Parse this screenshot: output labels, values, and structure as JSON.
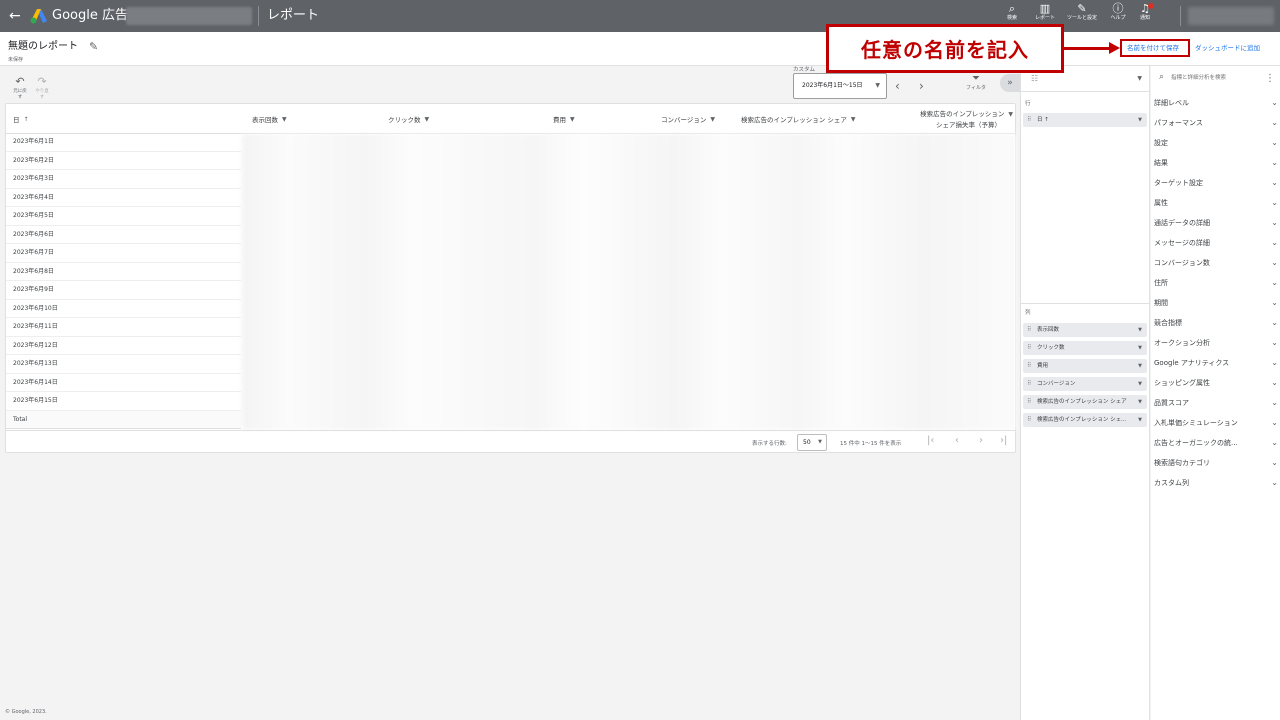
{
  "app": {
    "brand": "Google 広告",
    "page_title": "レポート"
  },
  "top_icons": [
    {
      "icon": "search-icon",
      "glyph": "🔍",
      "label": "検索"
    },
    {
      "icon": "reports-icon",
      "glyph": "▥",
      "label": "レポート"
    },
    {
      "icon": "tools-icon",
      "glyph": "🔧",
      "label": "ツールと設定"
    },
    {
      "icon": "help-icon",
      "glyph": "?",
      "label": "ヘルプ"
    },
    {
      "icon": "bell-icon",
      "glyph": "🔔",
      "label": "通知"
    }
  ],
  "header": {
    "report_name": "無題のレポート",
    "status": "未保存",
    "save_link": "名前を付けて保存",
    "dashboard_link": "ダッシュボードに追加"
  },
  "callout": {
    "text": "任意の名前を記入",
    "color": "#c00000"
  },
  "toolbar": {
    "undo": "元に戻す",
    "redo": "やり直す",
    "custom_label": "カスタム",
    "date_range": "2023年6月1日〜15日",
    "filter": "フィルタ"
  },
  "table": {
    "columns": [
      "日",
      "表示回数",
      "クリック数",
      "費用",
      "コンバージョン",
      "検索広告のインプレッション シェア",
      "検索広告のインプレッション シェア損失率（予算）"
    ],
    "col_last_line1": "検索広告のインプレッション",
    "col_last_line2": "シェア損失率（予算）",
    "rows": [
      "2023年6月1日",
      "2023年6月2日",
      "2023年6月3日",
      "2023年6月4日",
      "2023年6月5日",
      "2023年6月6日",
      "2023年6月7日",
      "2023年6月8日",
      "2023年6月9日",
      "2023年6月10日",
      "2023年6月11日",
      "2023年6月12日",
      "2023年6月13日",
      "2023年6月14日",
      "2023年6月15日"
    ],
    "total": "Total"
  },
  "pager": {
    "rows_label": "表示する行数:",
    "rows_value": "50",
    "info": "15 件中 1〜15 件を表示"
  },
  "footer": "© Google, 2023.",
  "middle_panel": {
    "rows_label": "行",
    "rows_chips": [
      "日"
    ],
    "cols_label": "列",
    "col_chips": [
      "表示回数",
      "クリック数",
      "費用",
      "コンバージョン",
      "検索広告のインプレッション シェア",
      "検索広告のインプレッション シェ..."
    ]
  },
  "right_panel": {
    "search_placeholder": "指標と詳細分析を検索",
    "categories": [
      "詳細レベル",
      "パフォーマンス",
      "設定",
      "結果",
      "ターゲット設定",
      "属性",
      "通話データの詳細",
      "メッセージの詳細",
      "コンバージョン数",
      "住所",
      "期間",
      "競合指標",
      "オークション分析",
      "Google アナリティクス",
      "ショッピング属性",
      "品質スコア",
      "入札単価シミュレーション",
      "広告とオーガニックの統...",
      "検索語句カテゴリ",
      "カスタム列"
    ]
  },
  "colors": {
    "topbar": "#5f6368",
    "link": "#1a73e8",
    "highlight": "#c00000"
  }
}
